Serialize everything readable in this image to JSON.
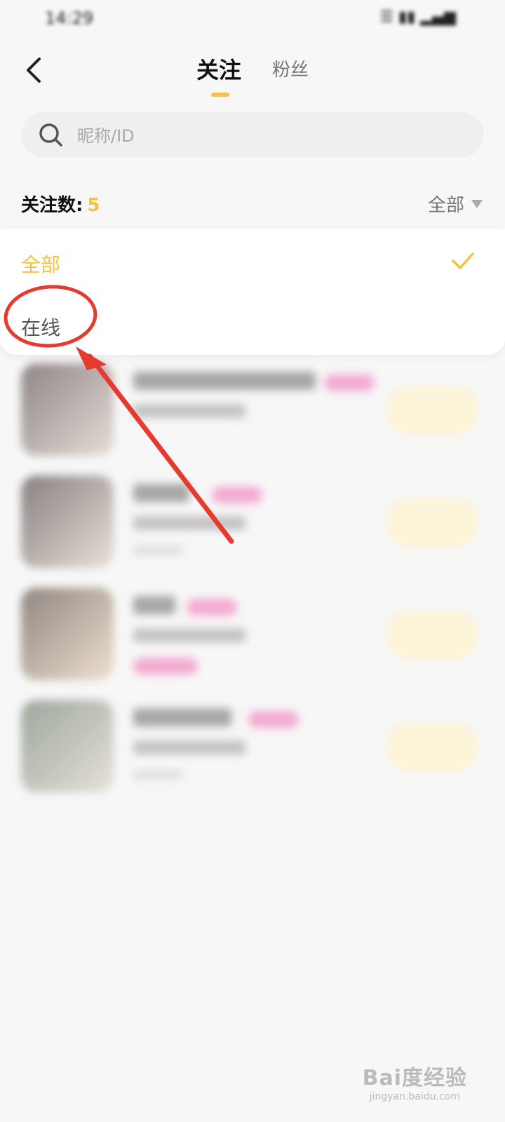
{
  "status_bar": {
    "time": "14:29",
    "icons": "☰ ▮▮ ▂▄▆"
  },
  "header": {
    "tabs": [
      "关注",
      "粉丝"
    ]
  },
  "search": {
    "placeholder": "昵称/ID"
  },
  "summary": {
    "label": "关注数:",
    "count": "5"
  },
  "filter": {
    "current": "全部",
    "options": [
      "全部",
      "在线"
    ],
    "selected_index": 0
  },
  "accent_color": "#f5c243",
  "icons": {
    "back": "chevron-left-icon",
    "search": "search-icon",
    "dropdown": "caret-down-icon",
    "check": "check-icon"
  },
  "watermark": {
    "logo": "Bai度经验",
    "url": "jingyan.baidu.com"
  }
}
